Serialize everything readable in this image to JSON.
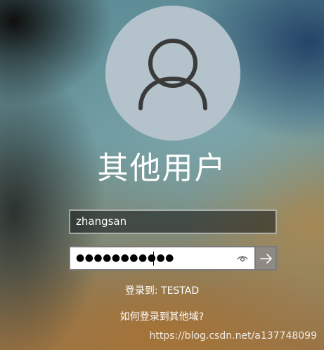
{
  "user_title": "其他用户",
  "username_field": {
    "value": "zhangsan"
  },
  "password_field": {
    "masked_value": "●●●●●●●●●●●"
  },
  "sign_in_to": "登录到: TESTAD",
  "other_domain_link": "如何登录到其他域?",
  "watermark": "https://blog.csdn.net/a137748099",
  "icons": {
    "avatar": "user-icon",
    "reveal": "eye-icon",
    "submit": "arrow-right-icon"
  }
}
